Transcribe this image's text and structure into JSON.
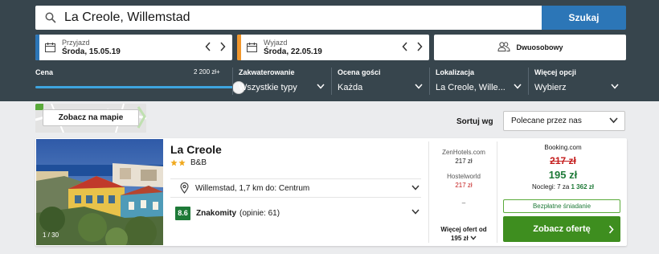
{
  "search": {
    "query": "La Creole, Willemstad",
    "button_label": "Szukaj"
  },
  "dates": {
    "checkin": {
      "label": "Przyjazd",
      "value": "Środa, 15.05.19"
    },
    "checkout": {
      "label": "Wyjazd",
      "value": "Środa, 22.05.19"
    }
  },
  "room": {
    "label": "Dwuosobowy"
  },
  "filters": {
    "price": {
      "label": "Cena",
      "max": "2 200 zł+",
      "fraction": 0.98
    },
    "accommodation": {
      "label": "Zakwaterowanie",
      "value": "Wszystkie typy"
    },
    "guest_rating": {
      "label": "Ocena gości",
      "value": "Każda"
    },
    "location": {
      "label": "Lokalizacja",
      "value": "La Creole, Wille..."
    },
    "more": {
      "label": "Więcej opcji",
      "value": "Wybierz"
    }
  },
  "map": {
    "button_label": "Zobacz na mapie"
  },
  "sort": {
    "label": "Sortuj wg",
    "value": "Polecane przez nas"
  },
  "hotel": {
    "photo_counter": "1 / 30",
    "name": "La Creole",
    "stars": 2,
    "type": "B&B",
    "location": "Willemstad, 1,7 km do: Centrum",
    "rating": {
      "score": "8.6",
      "word": "Znakomity",
      "count": "(opinie: 61)"
    },
    "offers": [
      {
        "site": "ZenHotels.com",
        "price": "217 zł",
        "red": false
      },
      {
        "site": "Hostelworld",
        "price": "217 zł",
        "red": true
      }
    ],
    "offers_dash": "–",
    "more_offers_line1": "Więcej ofert od",
    "more_offers_line2": "195 zł",
    "best": {
      "site": "Booking.com",
      "old_price": "217 zł",
      "price": "195 zł",
      "nights_prefix": "Noclegi: 7 za ",
      "nights_total": "1 362 zł",
      "perk": "Bezpłatne śniadanie",
      "cta": "Zobacz ofertę"
    }
  },
  "colors": {
    "header_bg": "#37454d",
    "search_button": "#2c76b7",
    "checkin_stripe": "#2c76b7",
    "checkout_stripe": "#f0962c",
    "slider": "#3ea4de",
    "price_red": "#c41d1d",
    "deal_green": "#1e7a38",
    "cta_green": "#3e8e1f",
    "star": "#f0a91e"
  },
  "icons": {
    "search": "search-icon",
    "calendar": "calendar-icon",
    "arrows": "chevron-left-right-icons",
    "room": "people-icon",
    "location": "map-pin-icon",
    "dropdown": "chevron-down-icon",
    "cta": "chevron-right-icon"
  }
}
